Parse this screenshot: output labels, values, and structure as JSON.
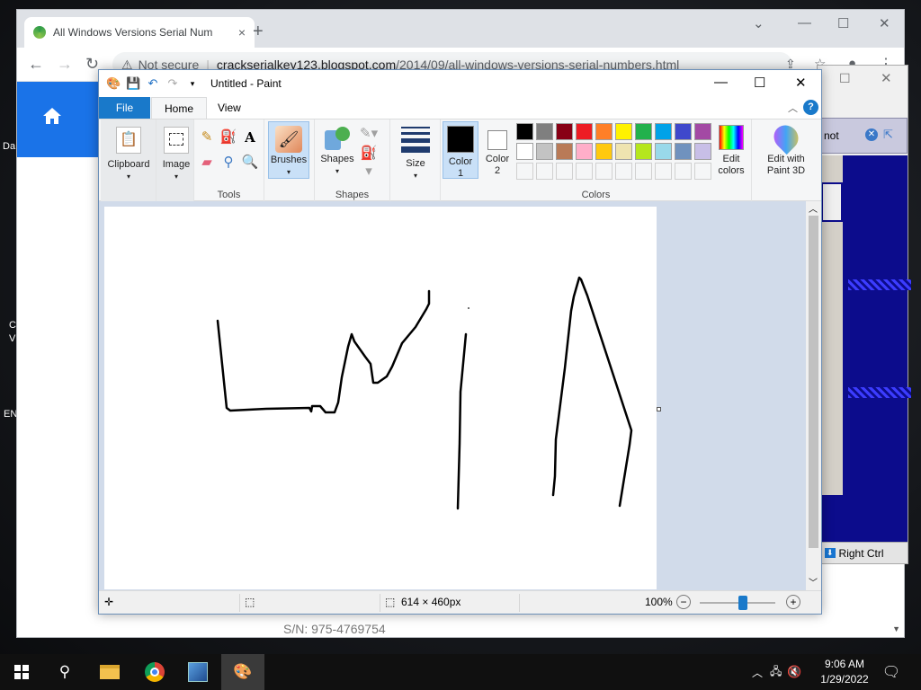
{
  "desktop": {
    "left_edge_labels": [
      "Da",
      "C",
      "V",
      "EN"
    ]
  },
  "chrome": {
    "tab_title": "All Windows Versions Serial Num",
    "tab_close": "×",
    "new_tab": "+",
    "address": {
      "security_label": "Not secure",
      "host": "crackserialkey123.blogspot.com",
      "path": "/2014/09/all-windows-versions-serial-numbers.html"
    },
    "page_footer_text": "S/N: 975-4769754"
  },
  "vbox": {
    "bar_text": "not",
    "status_text": "Right Ctrl"
  },
  "paint": {
    "title": "Untitled - Paint",
    "tabs": {
      "file": "File",
      "home": "Home",
      "view": "View"
    },
    "groups": {
      "clipboard": "Clipboard",
      "image": "Image",
      "tools": "Tools",
      "brushes": "Brushes",
      "shapes": "Shapes",
      "shapes_group": "Shapes",
      "size": "Size",
      "color1": "Color 1",
      "color2": "Color 2",
      "colors": "Colors",
      "edit_colors": "Edit colors",
      "paint3d": "Edit with Paint 3D"
    },
    "palette_row1": [
      "#000000",
      "#7f7f7f",
      "#880015",
      "#ed1c24",
      "#ff7f27",
      "#fff200",
      "#22b14c",
      "#00a2e8",
      "#3f48cc",
      "#a349a4"
    ],
    "palette_row2": [
      "#ffffff",
      "#c3c3c3",
      "#b97a57",
      "#ffaec9",
      "#ffc90e",
      "#efe4b0",
      "#b5e61d",
      "#99d9ea",
      "#7092be",
      "#c8bfe7"
    ],
    "color1_value": "#000000",
    "color2_value": "#ffffff",
    "status": {
      "dimensions": "614 × 460px",
      "zoom": "100%",
      "zoom_fraction": 0.57
    }
  },
  "taskbar": {
    "time": "9:06 AM",
    "date": "1/29/2022"
  }
}
